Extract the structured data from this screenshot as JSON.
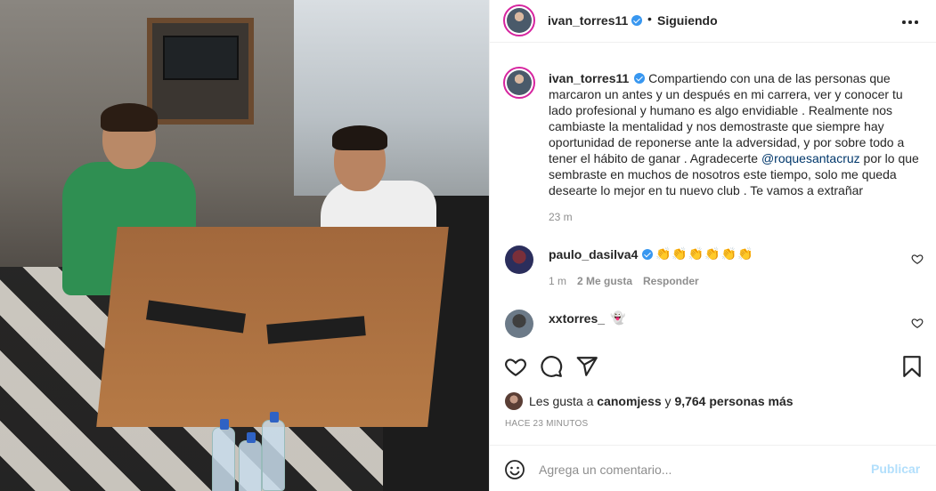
{
  "header": {
    "username": "ivan_torres11",
    "separator": "•",
    "follow_status": "Siguiendo"
  },
  "caption": {
    "username": "ivan_torres11",
    "text_before": "Compartiendo con una de las personas que marcaron un antes y un después en mi carrera, ver y conocer tu lado profesional y humano es algo envidiable . Realmente nos cambiaste la mentalidad y nos demostraste que siempre hay oportunidad de reponerse ante la adversidad, y por sobre todo a tener el hábito de ganar . Agradecerte ",
    "mention": "@roquesantacruz",
    "text_after": " por lo que sembraste en muchos de nosotros este tiempo, solo me queda desearte lo mejor en tu nuevo club . Te vamos a extrañar",
    "time": "23 m"
  },
  "comments": [
    {
      "username": "paulo_dasilva4",
      "text": "👏👏👏👏👏👏",
      "time": "1 m",
      "likes": "2 Me gusta",
      "reply": "Responder"
    },
    {
      "username": "xxtorres_",
      "text": "👻"
    }
  ],
  "likes": {
    "prefix": "Les gusta a ",
    "first_user": "canomjess",
    "connector": " y ",
    "others": "9,764 personas más"
  },
  "timestamp": "HACE 23 MINUTOS",
  "add_comment": {
    "placeholder": "Agrega un comentario...",
    "post_label": "Publicar"
  },
  "colors": {
    "verified": "#3897f0",
    "mention": "#00376b",
    "post_disabled": "#b2dffc",
    "muted": "#8e8e8e"
  }
}
